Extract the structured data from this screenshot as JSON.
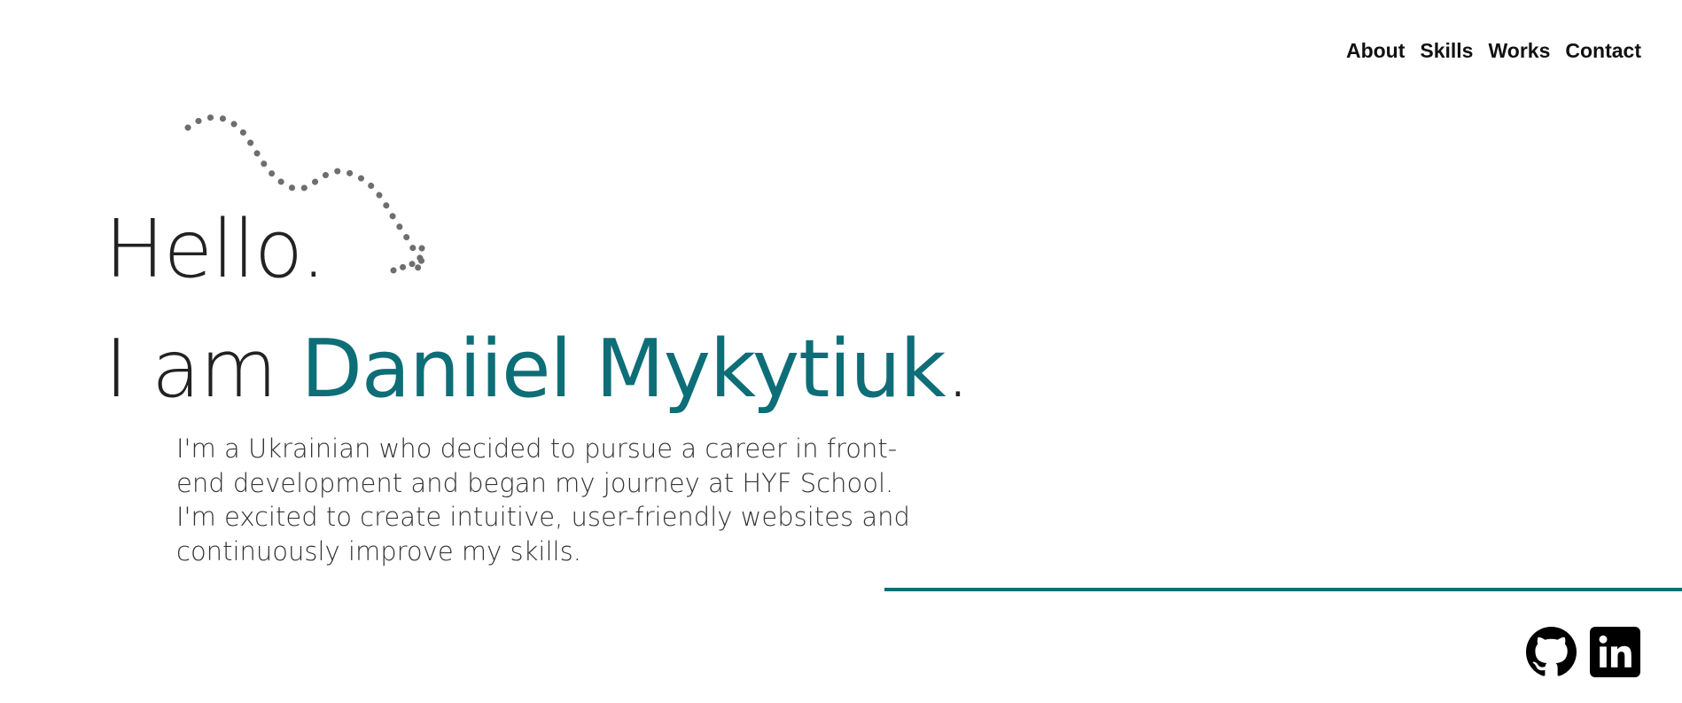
{
  "nav": {
    "items": [
      {
        "label": "About"
      },
      {
        "label": "Skills"
      },
      {
        "label": "Works"
      },
      {
        "label": "Contact"
      }
    ]
  },
  "hero": {
    "greeting": "Hello.",
    "intro_prefix": "I am ",
    "name": "Daniiel Mykytiuk",
    "intro_suffix": ".",
    "bio": "I'm a Ukrainian who decided to pursue a career in front-end development and began my journey at HYF School. I'm excited to create intuitive, user-friendly websites and continuously improve my skills."
  },
  "social": {
    "icons": [
      "github-icon",
      "linkedin-icon"
    ]
  },
  "colors": {
    "accent": "#0d6e77",
    "text": "#222222",
    "doodle": "#6e6e6e",
    "background": "#ffffff"
  }
}
